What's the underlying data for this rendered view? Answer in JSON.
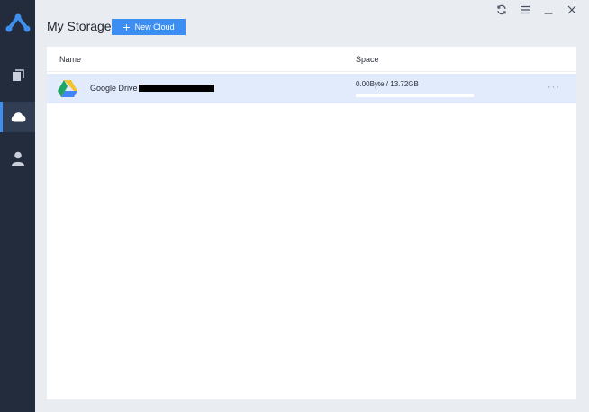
{
  "window": {
    "controls": {
      "refresh_icon": "refresh-icon",
      "menu_icon": "menu-icon",
      "minimize_icon": "minimize-icon",
      "close_icon": "close-icon"
    }
  },
  "sidebar": {
    "items": [
      {
        "icon": "copy-icon",
        "active": false
      },
      {
        "icon": "cloud-icon",
        "active": true
      },
      {
        "icon": "user-icon",
        "active": false
      }
    ],
    "accent": "#3f8ff0",
    "background": "#232c3d"
  },
  "header": {
    "title": "My Storage",
    "new_cloud_label": "New Cloud",
    "new_cloud_color": "#3d8ef1"
  },
  "table": {
    "columns": [
      "Name",
      "Space"
    ],
    "rows": [
      {
        "name": "Google Drive",
        "name_redacted": true,
        "space": "0.00Byte / 13.72GB",
        "used_fraction": 0,
        "more_label": "···",
        "selected": true
      }
    ]
  }
}
